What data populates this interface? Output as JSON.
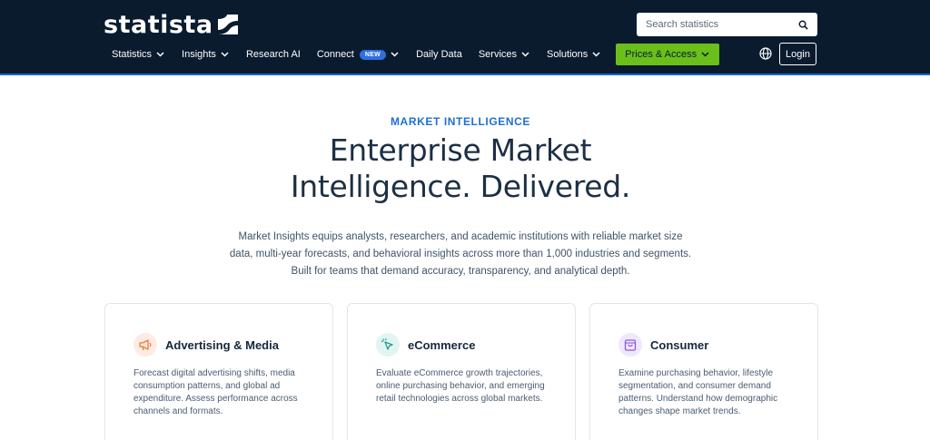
{
  "header": {
    "logo_text": "statista",
    "search_placeholder": "Search statistics",
    "login_label": "Login",
    "nav": [
      {
        "label": "Statistics",
        "dropdown": true
      },
      {
        "label": "Insights",
        "dropdown": true
      },
      {
        "label": "Research AI",
        "dropdown": false
      },
      {
        "label": "Connect",
        "badge": "NEW",
        "dropdown": true
      },
      {
        "label": "Daily Data",
        "dropdown": false
      },
      {
        "label": "Services",
        "dropdown": true
      },
      {
        "label": "Solutions",
        "dropdown": true
      },
      {
        "label": "Prices & Access",
        "dropdown": true,
        "highlight": true
      }
    ]
  },
  "hero": {
    "eyebrow": "MARKET INTELLIGENCE",
    "title_line1": "Enterprise Market",
    "title_line2": "Intelligence. Delivered.",
    "description": "Market Insights equips analysts, researchers, and academic institutions with reliable market size data, multi-year forecasts, and behavioral insights across more than 1,000 industries and segments. Built for teams that demand accuracy, transparency, and analytical depth."
  },
  "cards": [
    {
      "title": "Advertising & Media",
      "icon": "megaphone-icon",
      "icon_color": "#f07a3a",
      "icon_bg": "#fdece3",
      "description": "Forecast digital advertising shifts, media consumption patterns, and global ad expenditure. Assess performance across channels and formats."
    },
    {
      "title": "eCommerce",
      "icon": "cursor-click-icon",
      "icon_color": "#1f9e8f",
      "icon_bg": "#e2f5f2",
      "description": "Evaluate eCommerce growth trajectories, online purchasing behavior, and emerging retail technologies across global markets."
    },
    {
      "title": "Consumer",
      "icon": "shopping-bag-icon",
      "icon_color": "#8e5bd6",
      "icon_bg": "#efe7fb",
      "description": "Examine purchasing behavior, lifestyle segmentation, and consumer demand patterns. Understand how demographic changes shape market trends."
    }
  ],
  "colors": {
    "header_bg": "#0a1b2e",
    "accent_blue": "#1f6fd6",
    "cta_green": "#6bbf1a"
  }
}
